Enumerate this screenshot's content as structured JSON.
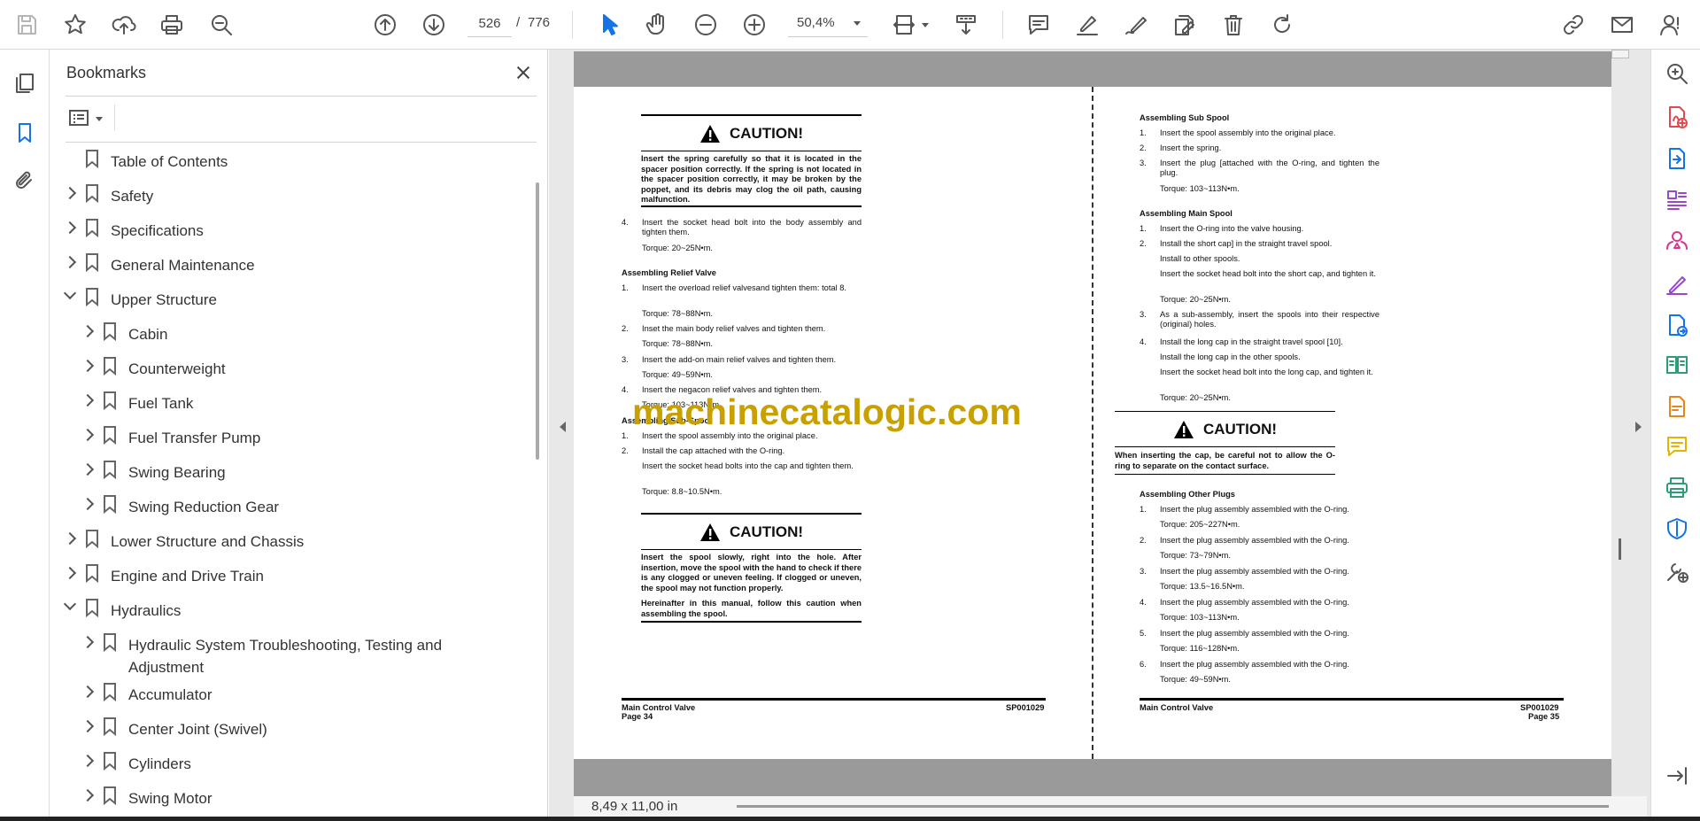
{
  "toolbar": {
    "page_current": "526",
    "page_separator": "/",
    "page_total": "776",
    "zoom": "50,4%"
  },
  "bookmarks": {
    "title": "Bookmarks",
    "items": [
      {
        "label": "Table of Contents",
        "state": "none"
      },
      {
        "label": "Safety",
        "state": "collapsed"
      },
      {
        "label": "Specifications",
        "state": "collapsed"
      },
      {
        "label": "General Maintenance",
        "state": "collapsed"
      },
      {
        "label": "Upper Structure",
        "state": "expanded"
      },
      {
        "label": "Cabin",
        "state": "collapsed"
      },
      {
        "label": "Counterweight",
        "state": "collapsed"
      },
      {
        "label": "Fuel Tank",
        "state": "collapsed"
      },
      {
        "label": "Fuel Transfer Pump",
        "state": "collapsed"
      },
      {
        "label": "Swing Bearing",
        "state": "collapsed"
      },
      {
        "label": "Swing Reduction Gear",
        "state": "collapsed"
      },
      {
        "label": "Lower Structure and Chassis",
        "state": "collapsed"
      },
      {
        "label": "Engine and Drive Train",
        "state": "collapsed"
      },
      {
        "label": "Hydraulics",
        "state": "expanded"
      },
      {
        "label": "Hydraulic System Troubleshooting, Testing and",
        "label2": "Adjustment",
        "state": "collapsed"
      },
      {
        "label": "Accumulator",
        "state": "collapsed"
      },
      {
        "label": "Center Joint (Swivel)",
        "state": "collapsed"
      },
      {
        "label": "Cylinders",
        "state": "collapsed"
      },
      {
        "label": "Swing Motor",
        "state": "collapsed"
      }
    ]
  },
  "document": {
    "page_size": "8,49 x 11,00 in",
    "watermark": "machinecatalogic.com",
    "left_page": {
      "caution1": {
        "heading": "CAUTION!",
        "body": "Insert the spring carefully so that it is located in the spacer position correctly. If the spring is not located in the spacer position correctly, it may be broken by the poppet, and its debris may clog the oil path, causing malfunction."
      },
      "step4": {
        "n": "4.",
        "text": "Insert the socket head bolt into the body assembly and tighten them.",
        "torque": "Torque: 20~25N•m."
      },
      "relief": {
        "title": "Assembling Relief Valve",
        "s1": {
          "n": "1.",
          "text": "Insert the overload relief valvesand tighten them: total 8.",
          "torque": "Torque: 78~88N•m."
        },
        "s2": {
          "n": "2.",
          "text": "Inset the main body relief valves and tighten them.",
          "torque": "Torque: 78~88N•m."
        },
        "s3": {
          "n": "3.",
          "text": "Insert the add-on main relief valves and tighten them.",
          "torque": "Torque: 49~59N•m."
        },
        "s4": {
          "n": "4.",
          "text": "Insert the negacon relief valves and tighten them.",
          "torque": "Torque: 103~113N•m."
        }
      },
      "subspool": {
        "title": "Assembling Sub-Spool",
        "s1": {
          "n": "1.",
          "text": "Insert the spool assembly into the original place."
        },
        "s2": {
          "n": "2.",
          "text": "Install the cap attached with the O-ring.",
          "text2": "Insert the socket head bolts into the cap and tighten them.",
          "torque": "Torque: 8.8~10.5N•m."
        }
      },
      "caution2": {
        "heading": "CAUTION!",
        "body": "Insert the spool slowly, right into the hole. After insertion, move the spool with the hand to check if there is any clogged or uneven feeling. If clogged or uneven, the spool may not function properly.",
        "body2": "Hereinafter in this manual, follow this caution when assembling the spool."
      },
      "footer": {
        "left1": "Main Control Valve",
        "left2": "Page 34",
        "right": "SP001029"
      }
    },
    "right_page": {
      "subspool": {
        "title": "Assembling Sub Spool",
        "s1": {
          "n": "1.",
          "text": "Insert the spool assembly into the original place."
        },
        "s2": {
          "n": "2.",
          "text": "Insert the spring."
        },
        "s3": {
          "n": "3.",
          "text": "Insert the plug [attached with the O-ring, and tighten the plug.",
          "torque": "Torque: 103~113N•m."
        }
      },
      "mainspool": {
        "title": "Assembling Main Spool",
        "s1": {
          "n": "1.",
          "text": "Insert the O-ring into the valve housing."
        },
        "s2": {
          "n": "2.",
          "text": "Install the short cap] in the straight travel spool.",
          "text2": "Install to other spools.",
          "text3": "Insert the socket head bolt into the short cap, and tighten it.",
          "torque": "Torque: 20~25N•m."
        },
        "s3": {
          "n": "3.",
          "text": "As a sub-assembly, insert the spools into their respective (original) holes."
        },
        "s4": {
          "n": "4.",
          "text": "Install the long cap in the straight travel spool [10].",
          "text2": "Install the long cap in the other spools.",
          "text3": "Insert the socket head bolt into the long cap, and tighten it.",
          "torque": "Torque: 20~25N•m."
        }
      },
      "caution": {
        "heading": "CAUTION!",
        "body": "When inserting the cap, be careful not to allow the O-ring to separate on the contact surface."
      },
      "plugs": {
        "title": "Assembling Other Plugs",
        "items": [
          {
            "n": "1.",
            "text": "Insert the plug assembly assembled with the O-ring.",
            "torque": "Torque: 205~227N•m."
          },
          {
            "n": "2.",
            "text": "Insert the plug assembly assembled with the O-ring.",
            "torque": "Torque: 73~79N•m."
          },
          {
            "n": "3.",
            "text": "Insert the plug assembly assembled with the O-ring.",
            "torque": "Torque: 13.5~16.5N•m."
          },
          {
            "n": "4.",
            "text": "Insert the plug assembly assembled with the O-ring.",
            "torque": "Torque: 103~113N•m."
          },
          {
            "n": "5.",
            "text": "Insert the plug assembly assembled with the O-ring.",
            "torque": "Torque: 116~128N•m."
          },
          {
            "n": "6.",
            "text": "Insert the plug assembly assembled with the O-ring.",
            "torque": "Torque: 49~59N•m."
          }
        ]
      },
      "footer": {
        "left1": "Main Control Valve",
        "right1": "SP001029",
        "right2": "Page 35"
      }
    }
  },
  "colors": {
    "accent": "#1473e6",
    "watermark": "#c8a000",
    "right_rail": [
      "#555555",
      "#e34850",
      "#1473e6",
      "#9747d0",
      "#d83790",
      "#9747d0",
      "#1473e6",
      "#2d9d78",
      "#e68619",
      "#e6b400",
      "#2d9d78",
      "#1473e6",
      "#555555"
    ]
  },
  "icons": {
    "toolbar": [
      "save-icon",
      "star-icon",
      "upload-icon",
      "print-icon",
      "find-icon",
      "page-up-icon",
      "page-down-icon",
      "select-arrow-icon",
      "hand-icon",
      "zoom-out-icon",
      "zoom-in-icon",
      "fit-page-icon",
      "scroll-mode-icon",
      "comment-icon",
      "highlight-icon",
      "sign-icon",
      "fill-sign-icon",
      "delete-icon",
      "rotate-icon",
      "share-link-icon",
      "email-icon",
      "account-icon"
    ],
    "left_rail": [
      "pages-icon",
      "bookmark-icon",
      "attachment-icon"
    ],
    "right_rail": [
      "zoom-search-icon",
      "create-pdf-icon",
      "export-pdf-icon",
      "organize-pages-icon",
      "request-signatures-icon",
      "fill-sign-icon",
      "send-for-comments-icon",
      "compare-files-icon",
      "edit-pdf-icon",
      "comment-icon",
      "print-production-icon",
      "protect-icon",
      "more-tools-icon",
      "collapse-pane-icon"
    ]
  }
}
